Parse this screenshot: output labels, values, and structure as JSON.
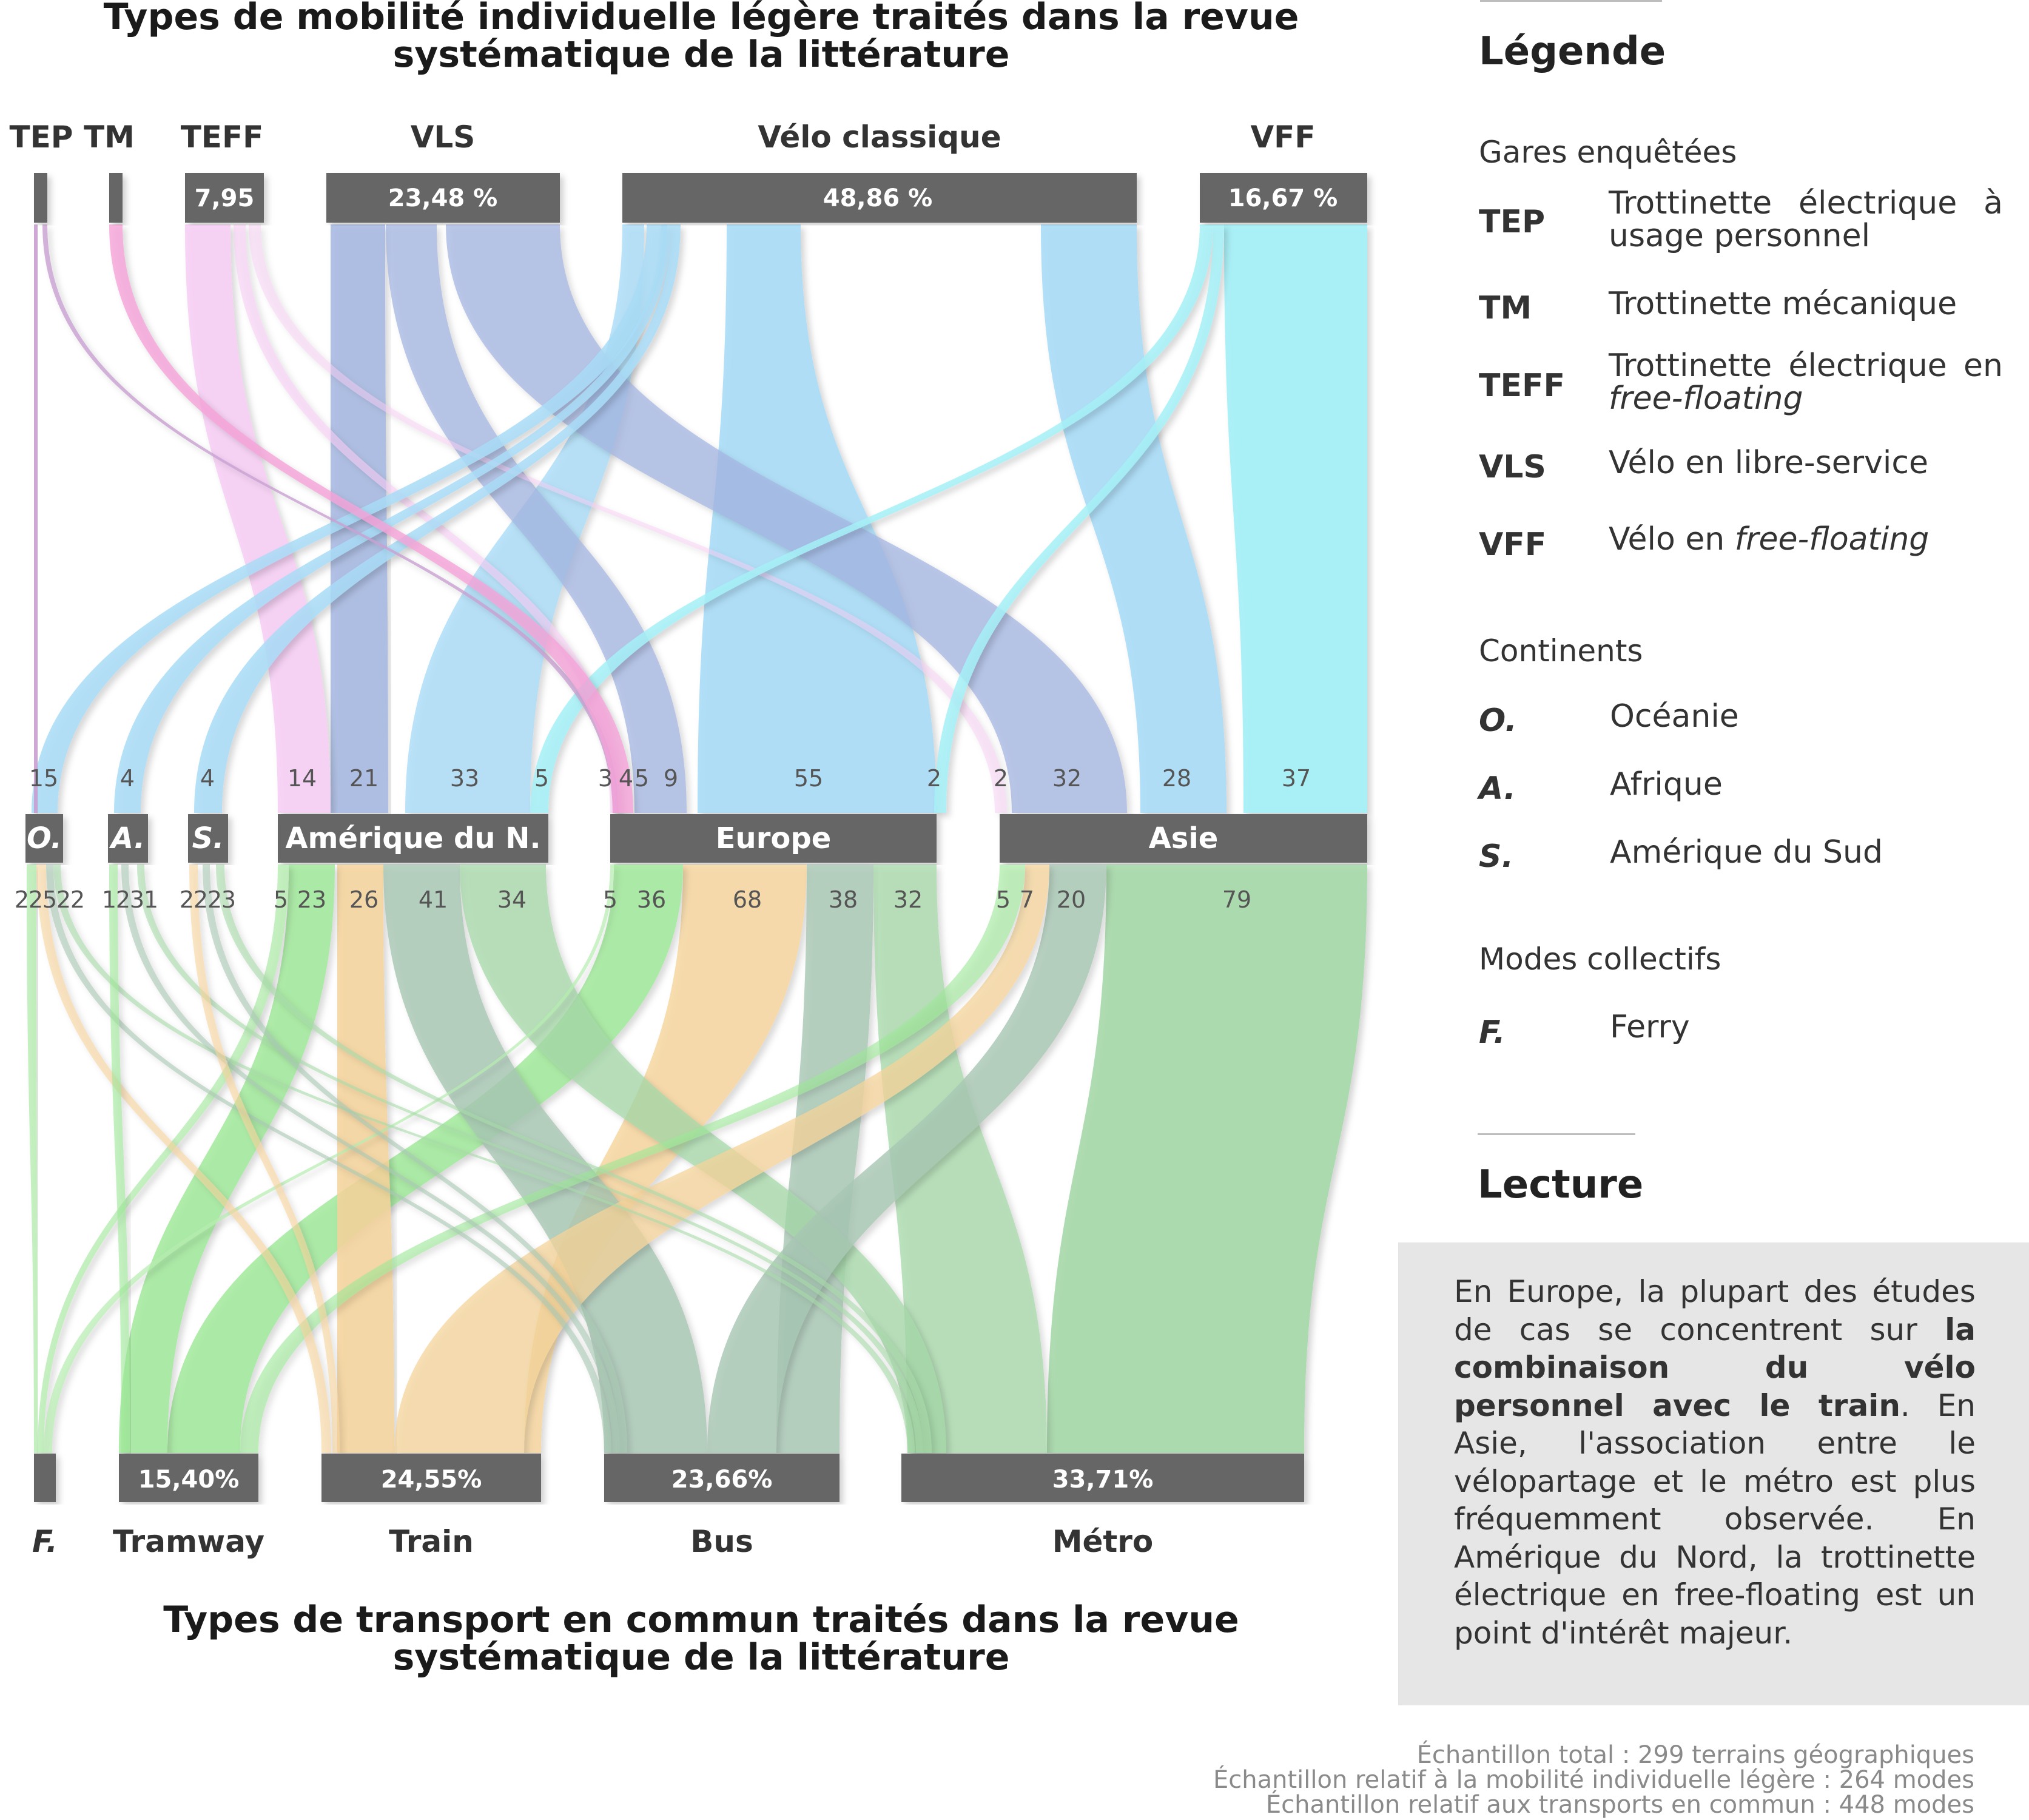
{
  "titles": {
    "top": [
      "Types de mobilité individuelle légère traités dans la revue",
      "systématique de la littérature"
    ],
    "bottom": [
      "Types de transport en commun traités dans la revue",
      "systématique de la littérature"
    ]
  },
  "chart_data": {
    "type": "sankey",
    "levels": [
      "Mobilité individuelle légère",
      "Continents",
      "Modes collectifs"
    ],
    "top_nodes": [
      {
        "id": "TEP",
        "label": "TEP",
        "bar_label": "",
        "color": "#c9a0d2"
      },
      {
        "id": "TM",
        "label": "TM",
        "bar_label": "",
        "color": "#f5a3d8"
      },
      {
        "id": "TEFF",
        "label": "TEFF",
        "bar_label": "7,95",
        "color": "#f7cdf4"
      },
      {
        "id": "VLS",
        "label": "VLS",
        "bar_label": "23,48 %",
        "color": "#a4b6e1"
      },
      {
        "id": "VC",
        "label": "Vélo classique",
        "bar_label": "48,86 %",
        "color": "#a9dcf7"
      },
      {
        "id": "VFF",
        "label": "VFF",
        "bar_label": "16,67 %",
        "color": "#a5f0f7"
      }
    ],
    "continent_nodes": [
      {
        "id": "O",
        "label": "O.",
        "italic": true
      },
      {
        "id": "A",
        "label": "A.",
        "italic": true
      },
      {
        "id": "S",
        "label": "S.",
        "italic": true
      },
      {
        "id": "AN",
        "label": "Amérique du N.",
        "italic": false
      },
      {
        "id": "EU",
        "label": "Europe",
        "italic": false
      },
      {
        "id": "AS",
        "label": "Asie",
        "italic": false
      }
    ],
    "bottom_nodes": [
      {
        "id": "F",
        "label": "F.",
        "bar_label": "",
        "italic": true,
        "color": "#b7ecb0"
      },
      {
        "id": "TRAM",
        "label": "Tramway",
        "bar_label": "15,40%",
        "italic": false,
        "color": "#9ce896"
      },
      {
        "id": "TRAIN",
        "label": "Train",
        "bar_label": "24,55%",
        "italic": false,
        "color": "#f6d49b"
      },
      {
        "id": "BUS",
        "label": "Bus",
        "bar_label": "23,66%",
        "italic": false,
        "color": "#a7c7b3"
      },
      {
        "id": "METRO",
        "label": "Métro",
        "bar_label": "33,71%",
        "italic": false,
        "color": "#a6d8a8"
      }
    ],
    "upper_values": [
      "15",
      "4",
      "4",
      "14",
      "21",
      "33",
      "5",
      "3",
      "4",
      "5",
      "9",
      "55",
      "2",
      "2",
      "32",
      "28",
      "37"
    ],
    "lower_values": [
      "2",
      "2",
      "5",
      "2",
      "2",
      "1",
      "2",
      "3",
      "1",
      "2",
      "2",
      "2",
      "3",
      "5",
      "23",
      "26",
      "41",
      "34",
      "5",
      "36",
      "68",
      "38",
      "32",
      "5",
      "7",
      "20",
      "79"
    ],
    "upper_flows": [
      {
        "source": "TEP",
        "target": "O",
        "value": null
      },
      {
        "source": "TEP",
        "target": "EU",
        "value": null
      },
      {
        "source": "TM",
        "target": "EU",
        "value": 3
      },
      {
        "source": "TEFF",
        "target": "AN",
        "value": 14
      },
      {
        "source": "TEFF",
        "target": "EU",
        "value": 4
      },
      {
        "source": "TEFF",
        "target": "AS",
        "value": 2
      },
      {
        "source": "VLS",
        "target": "AN",
        "value": 21
      },
      {
        "source": "VLS",
        "target": "EU",
        "value": 5
      },
      {
        "source": "VLS",
        "target": "AS",
        "value": 32
      },
      {
        "source": "VC",
        "target": "O",
        "value": 15
      },
      {
        "source": "VC",
        "target": "A",
        "value": 4
      },
      {
        "source": "VC",
        "target": "S",
        "value": 4
      },
      {
        "source": "VC",
        "target": "AN",
        "value": 33
      },
      {
        "source": "VC",
        "target": "EU",
        "value": 55
      },
      {
        "source": "VC",
        "target": "AS",
        "value": 28
      },
      {
        "source": "VFF",
        "target": "AN",
        "value": 5
      },
      {
        "source": "VFF",
        "target": "EU",
        "value": 2
      },
      {
        "source": "VFF",
        "target": "AS",
        "value": 37
      }
    ],
    "lower_flows": [
      {
        "source": "AN",
        "target": "F",
        "value": 5
      },
      {
        "source": "AN",
        "target": "TRAM",
        "value": 23
      },
      {
        "source": "AN",
        "target": "TRAIN",
        "value": 26
      },
      {
        "source": "AN",
        "target": "BUS",
        "value": 41
      },
      {
        "source": "AN",
        "target": "METRO",
        "value": 34
      },
      {
        "source": "EU",
        "target": "F",
        "value": 5
      },
      {
        "source": "EU",
        "target": "TRAM",
        "value": 36
      },
      {
        "source": "EU",
        "target": "TRAIN",
        "value": 68
      },
      {
        "source": "EU",
        "target": "BUS",
        "value": 38
      },
      {
        "source": "EU",
        "target": "METRO",
        "value": 32
      },
      {
        "source": "AS",
        "target": "TRAM",
        "value": 5
      },
      {
        "source": "AS",
        "target": "TRAIN",
        "value": 7
      },
      {
        "source": "AS",
        "target": "BUS",
        "value": 20
      },
      {
        "source": "AS",
        "target": "METRO",
        "value": 79
      }
    ]
  },
  "legend": {
    "title": "Légende",
    "groups": [
      {
        "title": "Gares enquêtées",
        "items": [
          {
            "abbr": "TEP",
            "italic": false,
            "text": "Trottinette électrique à usage personnel"
          },
          {
            "abbr": "TM",
            "italic": false,
            "text": "Trottinette mécanique"
          },
          {
            "abbr": "TEFF",
            "italic": false,
            "text": "Trottinette électrique en free-floating"
          },
          {
            "abbr": "VLS",
            "italic": false,
            "text": "Vélo en libre-service"
          },
          {
            "abbr": "VFF",
            "italic": false,
            "text": "Vélo en free-floating"
          }
        ]
      },
      {
        "title": "Continents",
        "items": [
          {
            "abbr": "O.",
            "italic": true,
            "text": "Océanie"
          },
          {
            "abbr": "A.",
            "italic": true,
            "text": "Afrique"
          },
          {
            "abbr": "S.",
            "italic": true,
            "text": "Amérique du Sud"
          }
        ]
      },
      {
        "title": "Modes collectifs",
        "items": [
          {
            "abbr": "F.",
            "italic": true,
            "text": "Ferry"
          }
        ]
      }
    ]
  },
  "lecture": {
    "title": "Lecture",
    "text": "En Europe, la plupart des études de cas se concentrent sur la combinaison du vélo personnel avec le train. En Asie, l'association entre le vélopartage et le métro est plus fréquemment observée. En Amérique du Nord, la trottinette électrique en free-floating est un point d'intérêt majeur.",
    "emphasis": "la combinaison du vélo personnel avec le train"
  },
  "footnotes": [
    "Échantillon total : 299 terrains géographiques",
    "Échantillon relatif à la mobilité individuelle légère : 264 modes",
    "Échantillon relatif aux transports en commun : 448 modes"
  ],
  "colors": {
    "node_bar": "#666666",
    "teff_flow": "#f7cdf4",
    "tep_flow": "#c9a0d2",
    "tm_flow": "#f5a3d8",
    "vls_flow": "#a4b6e1",
    "vc_flow": "#a9dcf7",
    "vff_flow": "#a5f0f7",
    "tram_flow": "#9ce896",
    "train_flow": "#f6d49b",
    "bus_flow": "#a7c7b3",
    "metro_flow": "#a6d8a8",
    "ferry_flow": "#b7ecb0",
    "lecture_bg": "#e6e6e6"
  }
}
